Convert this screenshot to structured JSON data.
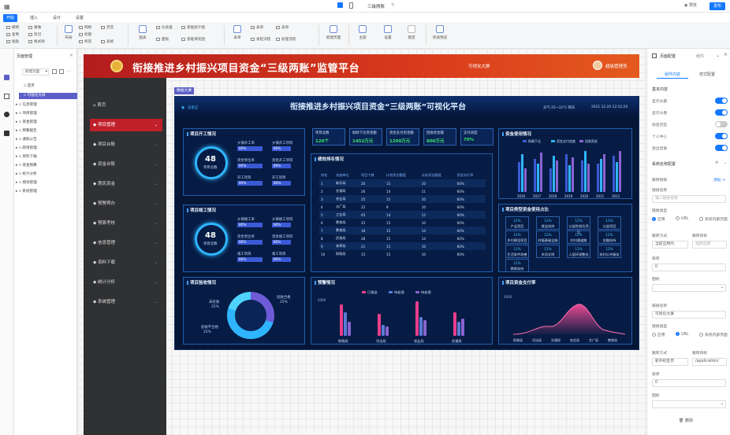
{
  "topbar": {
    "doc_title": "三级两账",
    "preview_label": "预览",
    "publish_label": "发布"
  },
  "menubar": {
    "tabs": [
      "开始",
      "插入",
      "设计",
      "设置"
    ]
  },
  "ribbon": {
    "undo": "撤销",
    "redo": "重做",
    "copy": "复制",
    "cut": "剪切",
    "paste": "粘贴",
    "format": "格式刷",
    "layout": "布局",
    "grid": "网格",
    "heading": "标题",
    "mark": "标签",
    "tab": "页签",
    "table": "表格",
    "chart": "图表",
    "mobile": "仪表盘",
    "layout2": "面板",
    "basic_stats": "基础统计图",
    "basic_fill": "基础填充图",
    "form": "表单",
    "sheet": "表单",
    "release": "发起流程",
    "process": "处理流程",
    "new_page": "新建页面",
    "theme": "主题",
    "settings": "设置",
    "lock": "锁定",
    "quick_preview": "快速预览"
  },
  "left_panel": {
    "title": "页面管理",
    "new_page": "新建页面",
    "items": [
      "首页",
      "可视化大屏",
      "信息管理",
      "项目管理",
      "资金管理",
      "预警报告",
      "通知公告",
      "政策管理",
      "资料下载",
      "资金预算",
      "统计分析",
      "绩效管理",
      "系统管理"
    ]
  },
  "app": {
    "title": "衔接推进乡村振兴项目资金“三级两账”监管平台",
    "subtitle": "可视化大屏",
    "user": "超级管理员",
    "nav": [
      "首页",
      "项目管理",
      "项目台账",
      "资金台账",
      "惠民资金",
      "预警舆办",
      "预算考核",
      "信息管理",
      "资料下载",
      "统计分析",
      "系统管理"
    ],
    "canvas_tab": "数据大屏"
  },
  "dashboard": {
    "title": "衔接推进乡村振兴项目资金“三级两账”可视化平台",
    "region": "石家庄",
    "weather": "天气:25~32℃ 晴天",
    "date": "2021.12.20  12:12:20",
    "kpis": [
      {
        "label": "项目总数",
        "value": "120个"
      },
      {
        "label": "财政下达资金额",
        "value": "1452万元"
      },
      {
        "label": "资金支付资金额",
        "value": "1200万元"
      },
      {
        "label": "回收资金额",
        "value": "800万元"
      },
      {
        "label": "支付进度",
        "value": "70%"
      }
    ],
    "start_panel": {
      "title": "项目开工情况",
      "center_value": "48",
      "center_label": "项目总数",
      "bars": [
        [
          "乡镇开工率",
          "80%"
        ],
        [
          "乡镇开工项目",
          "80%"
        ],
        [
          "资金到位率",
          "80%"
        ],
        [
          "资金开工项目",
          "80%"
        ],
        [
          "开工项目",
          "80%"
        ],
        [
          "开工项目",
          "80%"
        ]
      ]
    },
    "done_panel": {
      "title": "项目竣工情况",
      "center_value": "48",
      "center_label": "项目总数",
      "bars": [
        [
          "乡镇竣工率",
          "80%"
        ],
        [
          "乡镇竣工项目",
          "80%"
        ],
        [
          "资金到位率",
          "80%"
        ],
        [
          "资金竣工项目",
          "80%"
        ],
        [
          "竣工项目",
          "80%"
        ],
        [
          "竣工项目",
          "80%"
        ]
      ]
    },
    "accept_panel": {
      "title": "项目验收情况",
      "labels": [
        "未验收",
        "25%",
        "验收合格",
        "25%",
        "验收不合格",
        "25%"
      ]
    },
    "perf_panel": {
      "title": "绩效排名情况",
      "headers": [
        "排名",
        "实施单位",
        "项目个数",
        "计划资金额度",
        "实际资金额度",
        "资金执行率"
      ],
      "rows": [
        [
          "1",
          "新乐局",
          "20",
          "15",
          "10",
          "60%"
        ],
        [
          "2",
          "交通局",
          "26",
          "14",
          "11",
          "60%"
        ],
        [
          "3",
          "农业局",
          "25",
          "15",
          "10",
          "60%"
        ],
        [
          "4",
          "水厂局",
          "22",
          "9",
          "10",
          "60%"
        ],
        [
          "5",
          "工业局",
          "45",
          "14",
          "12",
          "60%"
        ],
        [
          "6",
          "教育局",
          "25",
          "15",
          "10",
          "60%"
        ],
        [
          "7",
          "教育局",
          "18",
          "15",
          "14",
          "60%"
        ],
        [
          "8",
          "民政局",
          "28",
          "15",
          "14",
          "60%"
        ],
        [
          "9",
          "林草局",
          "21",
          "15",
          "10",
          "60%"
        ],
        [
          "10",
          "财政局",
          "15",
          "15",
          "10",
          "60%"
        ]
      ]
    },
    "warn_panel": {
      "title": "预警情况",
      "legend": [
        "已推送",
        "待处理",
        "待处理"
      ],
      "categories": [
        "财政局",
        "司法局",
        "农业局",
        "交通局"
      ],
      "ymax": "2000"
    },
    "fund_panel": {
      "title": "资金使用情况",
      "legend": [
        "财政下达",
        "资金支付进度",
        "回收资金"
      ],
      "years": [
        "2016",
        "2017",
        "2018",
        "2019",
        "2020",
        "2011",
        "2012"
      ]
    },
    "type_panel": {
      "title": "项目类型资金使用占比",
      "cells": [
        [
          "12%",
          "产业项目"
        ],
        [
          "12%",
          "就业扶持"
        ],
        [
          "12%",
          "公益性岗位项目"
        ],
        [
          "12%",
          "公益项目"
        ],
        [
          "12%",
          "乡村建设项目"
        ],
        [
          "12%",
          "村级基础设施"
        ],
        [
          "12%",
          "村村通道路"
        ],
        [
          "12%",
          "金融扶持"
        ],
        [
          "12%",
          "生活条件改善"
        ],
        [
          "12%",
          "乡风文明"
        ],
        [
          "12%",
          "人居环境整治"
        ],
        [
          "12%",
          "农村公共服务"
        ],
        [
          "12%",
          "教育扶持"
        ]
      ]
    },
    "pay_panel": {
      "title": "项目资金支付率",
      "categories": [
        "财政局",
        "司法局",
        "交通局",
        "农业局",
        "文广局",
        "教育局"
      ],
      "ymax": "2000"
    }
  },
  "right_panel": {
    "tab_page": "页面配置",
    "tab_app": "组件",
    "sub_tab_1": "组件内容",
    "sub_tab_2": "样式配置",
    "section_basic": "基本内容",
    "toggles": [
      [
        "显示头部",
        true
      ],
      [
        "显示头像",
        true
      ],
      [
        "标签页签",
        false
      ],
      [
        "个人中心",
        true
      ],
      [
        "退出登录",
        true
      ]
    ],
    "section_nav": "系统名称配置",
    "jump_link": "跳转链接",
    "add": "添加",
    "link_name_1": "链接名称",
    "link_name_1_value": "输入链接名称",
    "link_type_1": "链接类型",
    "app_label": "应用",
    "url_label": "URL",
    "sys_internal": "系统内部页面",
    "open_mode": "跳转方式",
    "open_value": "当前应用内",
    "app_choose": "跳转目标",
    "app_choose_value": "选择应用",
    "sort": "排序",
    "sort_value": "0",
    "icon": "图标",
    "link_name_2": "链接名称",
    "link_name_2_value": "可视化大屏",
    "link_type_2": "链接类型",
    "open_mode_2": "跳转方式",
    "open_value_2": "新开标签页",
    "target_2": "跳转目标",
    "target_value_2": "/application/",
    "sort_2": "排序",
    "sort_value_2": "0",
    "icon_2": "图标",
    "delete": "删除"
  }
}
